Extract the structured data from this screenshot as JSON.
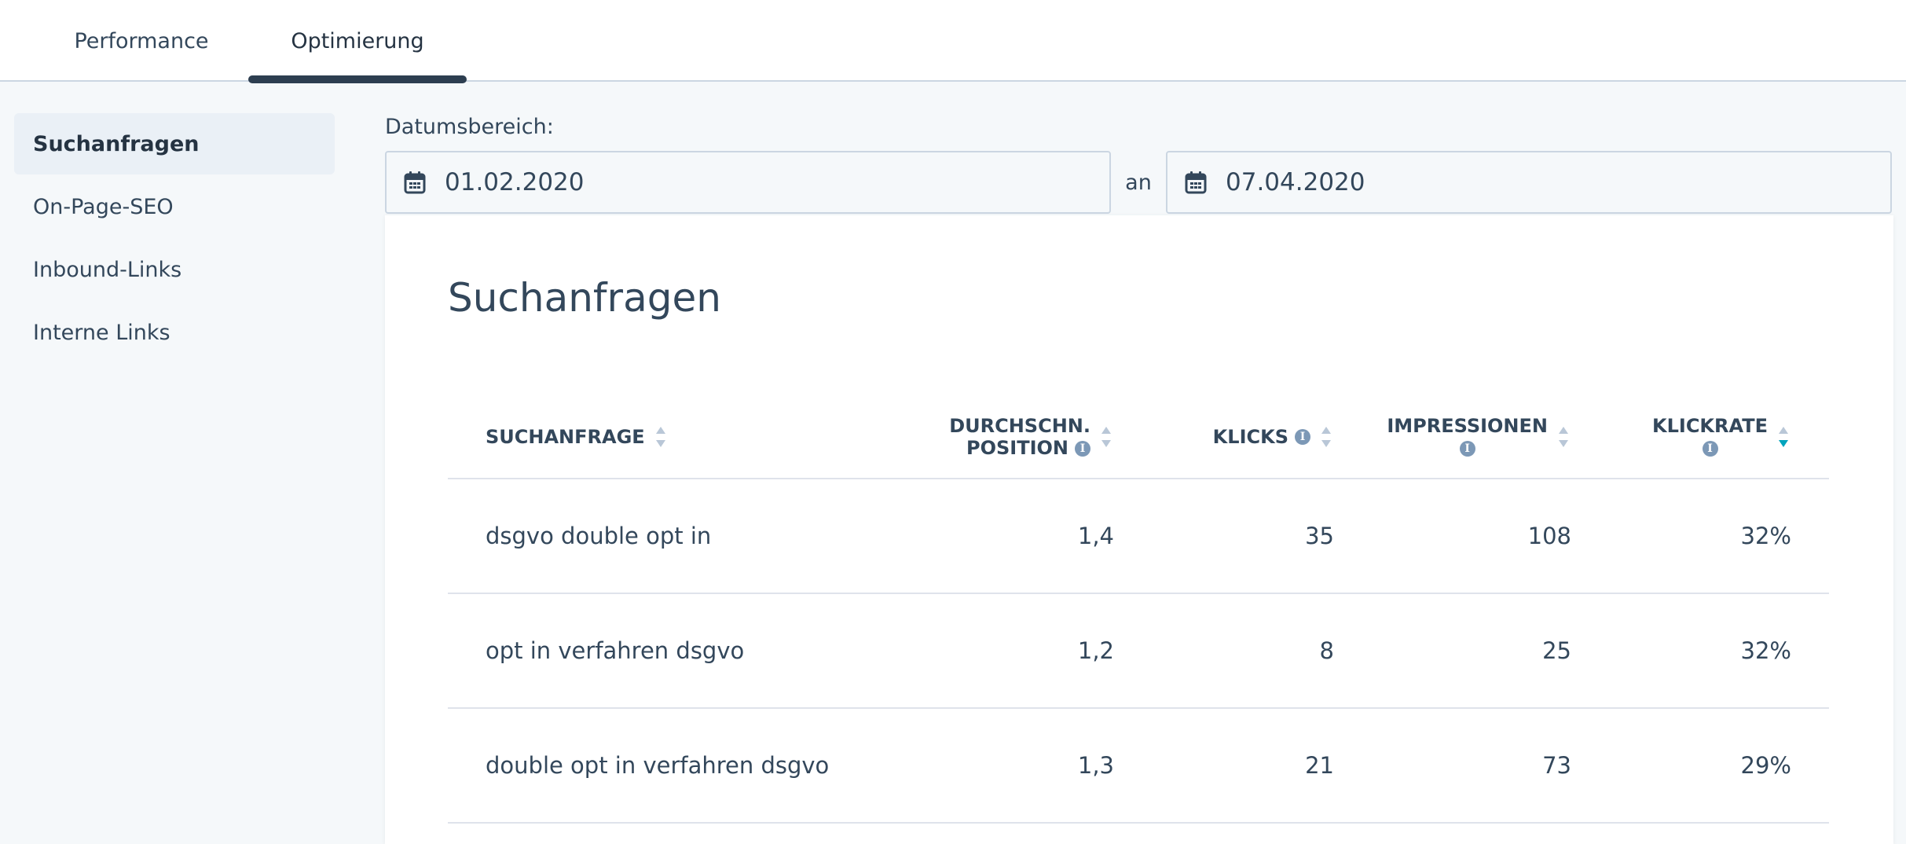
{
  "tabs": [
    {
      "label": "Performance",
      "active": false
    },
    {
      "label": "Optimierung",
      "active": true
    }
  ],
  "sidebar": {
    "items": [
      {
        "label": "Suchanfragen",
        "active": true
      },
      {
        "label": "On-Page-SEO",
        "active": false
      },
      {
        "label": "Inbound-Links",
        "active": false
      },
      {
        "label": "Interne Links",
        "active": false
      }
    ]
  },
  "date_range": {
    "label": "Datumsbereich:",
    "start": "01.02.2020",
    "separator": "an",
    "end": "07.04.2020"
  },
  "table": {
    "title": "Suchanfragen",
    "columns": [
      {
        "line1": "SUCHANFRAGE",
        "line2": "",
        "info": false,
        "sort": "none"
      },
      {
        "line1": "DURCHSCHN.",
        "line2": "POSITION",
        "info": true,
        "sort": "none"
      },
      {
        "line1": "KLICKS",
        "line2": "",
        "info": true,
        "sort": "none"
      },
      {
        "line1": "IMPRESSIONEN",
        "line2": "",
        "info": true,
        "sort": "none"
      },
      {
        "line1": "KLICKRATE",
        "line2": "",
        "info": true,
        "sort": "descending"
      }
    ],
    "rows": [
      {
        "query": "dsgvo double opt in",
        "position": "1,4",
        "clicks": "35",
        "impressions": "108",
        "ctr": "32%"
      },
      {
        "query": "opt in verfahren dsgvo",
        "position": "1,2",
        "clicks": "8",
        "impressions": "25",
        "ctr": "32%"
      },
      {
        "query": "double opt in verfahren dsgvo",
        "position": "1,3",
        "clicks": "21",
        "impressions": "73",
        "ctr": "29%"
      }
    ]
  },
  "colors": {
    "text": "#33475b",
    "tab_underline": "#2d3e50",
    "sort_active": "#00a4bd",
    "sort_inactive": "#b9c7d7",
    "info_icon": "#7c98b6"
  }
}
